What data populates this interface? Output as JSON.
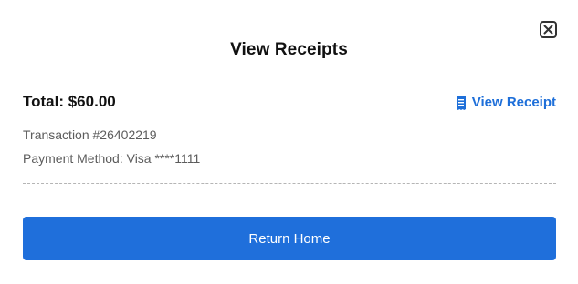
{
  "modal": {
    "title": "View Receipts",
    "close_icon": "close-x-icon"
  },
  "receipt": {
    "total": "Total: $60.00",
    "view_receipt_label": "View Receipt",
    "view_receipt_icon": "receipt-icon",
    "transaction": "Transaction #26402219",
    "payment_method": "Payment Method: Visa ****1111"
  },
  "actions": {
    "return_home_label": "Return Home"
  },
  "colors": {
    "accent": "#1f6fdb",
    "text_primary": "#111111",
    "text_secondary": "#5c5c5c"
  }
}
